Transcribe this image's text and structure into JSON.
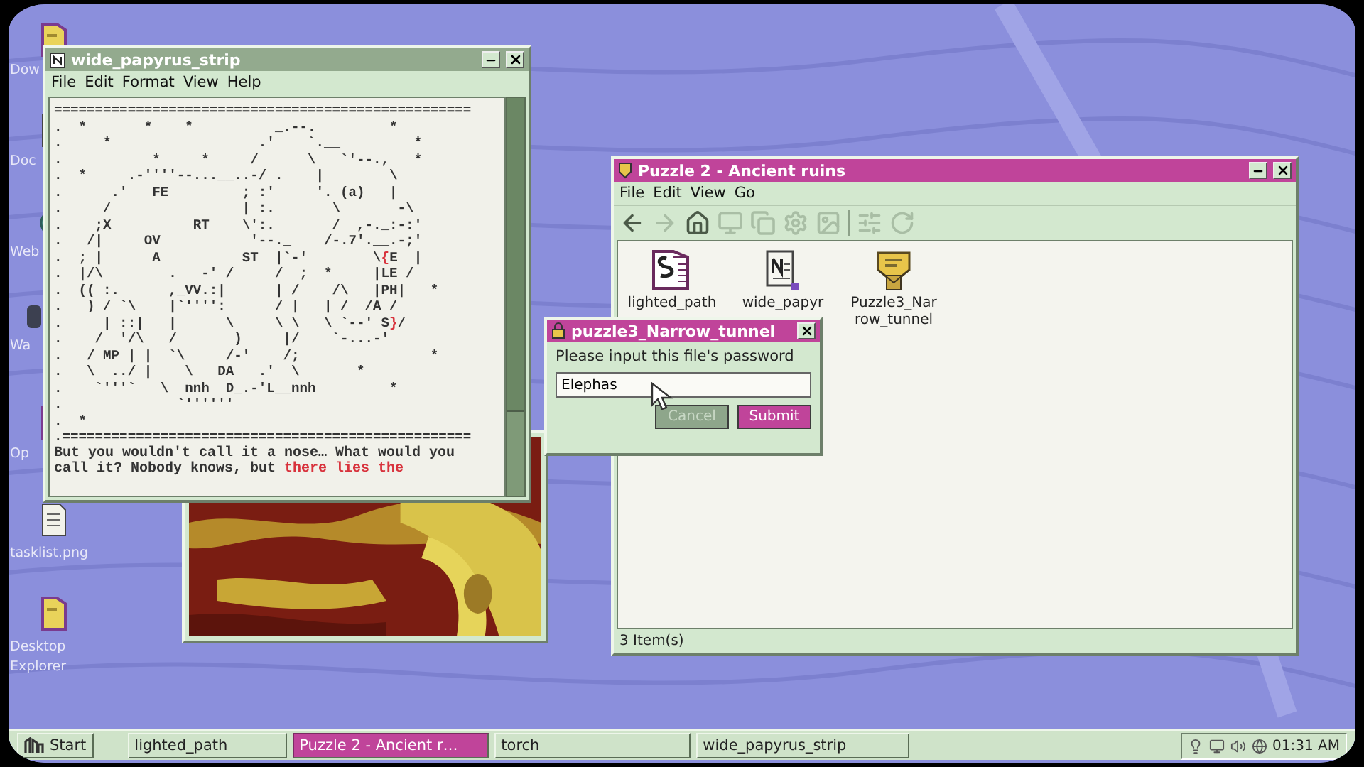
{
  "desktop_icons": [
    {
      "label": "Dow",
      "kind": "folder"
    },
    {
      "label": "Doc",
      "kind": "document"
    },
    {
      "label": "Web",
      "kind": "globe"
    },
    {
      "label": "Wa",
      "kind": "app"
    },
    {
      "label": "Op",
      "kind": "folder"
    },
    {
      "label": "tasklist.png",
      "kind": "document"
    },
    {
      "label": "Desktop\nExplorer",
      "kind": "folder"
    }
  ],
  "notepad": {
    "title": "wide_papyrus_strip",
    "active": false,
    "menu": [
      "File",
      "Edit",
      "Format",
      "View",
      "Help"
    ],
    "art_lines": [
      [
        {
          "text": "===================================================",
          "highlight": false
        }
      ],
      [
        {
          "text": ".  *       *    *          _.--.         *",
          "highlight": false
        }
      ],
      [
        {
          "text": ".     *                  .'    `.__         *",
          "highlight": false
        }
      ],
      [
        {
          "text": ".           *     *     /      \\   `'--.,   *",
          "highlight": false
        }
      ],
      [
        {
          "text": ".  *     .-''''--...__..-/ .    |        \\",
          "highlight": false
        }
      ],
      [
        {
          "text": ".      .'   FE         ; :'     '. (a)   |",
          "highlight": false
        }
      ],
      [
        {
          "text": ".     /                | :.       \\       -\\",
          "highlight": false
        }
      ],
      [
        {
          "text": ".    ;X          RT    \\':.       /  ,-._:-:'",
          "highlight": false
        }
      ],
      [
        {
          "text": ".   /|     OV           '--._    /-.7'.__.-;'",
          "highlight": false
        }
      ],
      [
        {
          "text": ".  ; |      A          ST  |`-'        \\",
          "highlight": false
        },
        {
          "text": "{",
          "highlight": true
        },
        {
          "text": "E  |",
          "highlight": false
        }
      ],
      [
        {
          "text": ".  |/\\        .   -' /     /  ;  *     |LE /",
          "highlight": false
        }
      ],
      [
        {
          "text": ".  (( :.      ,_VV.:|      | /    /\\   |PH|   *",
          "highlight": false
        }
      ],
      [
        {
          "text": ".   ) / `\\    |`'''':      / |   | /  /A /",
          "highlight": false
        }
      ],
      [
        {
          "text": ".     | ::|   |      \\     \\ \\   \\ `--' S",
          "highlight": false
        },
        {
          "text": "}",
          "highlight": true
        },
        {
          "text": "/",
          "highlight": false
        }
      ],
      [
        {
          "text": ".    /  '/\\   /       )     |/    `-...-'",
          "highlight": false
        }
      ],
      [
        {
          "text": ".   / MP | |  `\\     /-'    /;                *",
          "highlight": false
        }
      ],
      [
        {
          "text": ".   \\  ../ |    \\   DA   .'  \\       *",
          "highlight": false
        }
      ],
      [
        {
          "text": ".    `'''`   \\  nnh  D_.-'L__nnh         *",
          "highlight": false
        }
      ],
      [
        {
          "text": ".              `''''''",
          "highlight": false
        }
      ],
      [
        {
          "text": ".  *",
          "highlight": false
        }
      ],
      [
        {
          "text": ".==================================================",
          "highlight": false
        }
      ]
    ],
    "paragraph_lines": [
      [
        {
          "text": "But you wouldn't call it a nose… What would you",
          "highlight": false
        }
      ],
      [
        {
          "text": "call it? Nobody knows, but ",
          "highlight": false
        },
        {
          "text": "there lies the",
          "highlight": true
        }
      ]
    ]
  },
  "explorer": {
    "title": "Puzzle 2 - Ancient ruins",
    "active": true,
    "menu": [
      "File",
      "Edit",
      "View",
      "Go"
    ],
    "toolbar": [
      {
        "disabled": false
      },
      {
        "disabled": true
      },
      {
        "disabled": false
      },
      {
        "disabled": true
      },
      {
        "disabled": true
      },
      {
        "disabled": true
      },
      {
        "disabled": true
      },
      {
        "disabled": true
      },
      {
        "disabled": true
      }
    ],
    "files": [
      {
        "kind": "script",
        "label_lines": [
          "lighted_path"
        ]
      },
      {
        "kind": "text",
        "label_lines": [
          "wide_papyr"
        ]
      },
      {
        "kind": "locked",
        "label_lines": [
          "Puzzle3_Nar",
          "row_tunnel"
        ]
      }
    ],
    "status": "3 Item(s)"
  },
  "dialog": {
    "title": "puzzle3_Narrow_tunnel",
    "active": true,
    "prompt": "Please input this file's password",
    "value": "Elephas",
    "buttons": [
      {
        "label": "Cancel",
        "disabled": true
      },
      {
        "label": "Submit",
        "disabled": false
      }
    ]
  },
  "taskbar": {
    "start": "Start",
    "items": [
      {
        "label": "lighted_path",
        "selected": false
      },
      {
        "label": "Puzzle 2 - Ancient r…",
        "selected": true
      },
      {
        "label": "torch",
        "selected": false
      },
      {
        "label": "wide_papyrus_strip",
        "selected": false
      }
    ],
    "clock": "01:31 AM"
  }
}
